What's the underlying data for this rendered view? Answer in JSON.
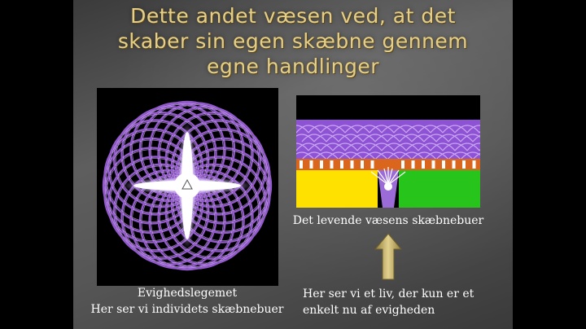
{
  "slide": {
    "title_lines": [
      "Dette andet væsen ved, at det",
      "skaber sin egen skæbne gennem",
      "egne handlinger"
    ],
    "left_caption_line1": "Evighedslegemet",
    "left_caption_line2": "Her ser vi individets skæbnebuer",
    "right_caption": "Det levende væsens skæbnebuer",
    "bottom_caption_line1": "Her ser vi et liv, der kun er et",
    "bottom_caption_line2": "enkelt nu af evigheden"
  },
  "colors": {
    "slide_background": "#555555",
    "title_gold": "#e4cf8a",
    "caption_white": "#ffffff",
    "ring_purple": "#9b5fd6",
    "arc_purple": "#8e52d4",
    "band_orange": "#d9661c",
    "field_yellow": "#ffe100",
    "field_green": "#27c41c",
    "arrow_gold": "#c8b46a"
  },
  "icons": {
    "arrow": "up-arrow-icon",
    "left_image": "eternity-body-diagram",
    "right_image": "fate-arcs-diagram"
  }
}
